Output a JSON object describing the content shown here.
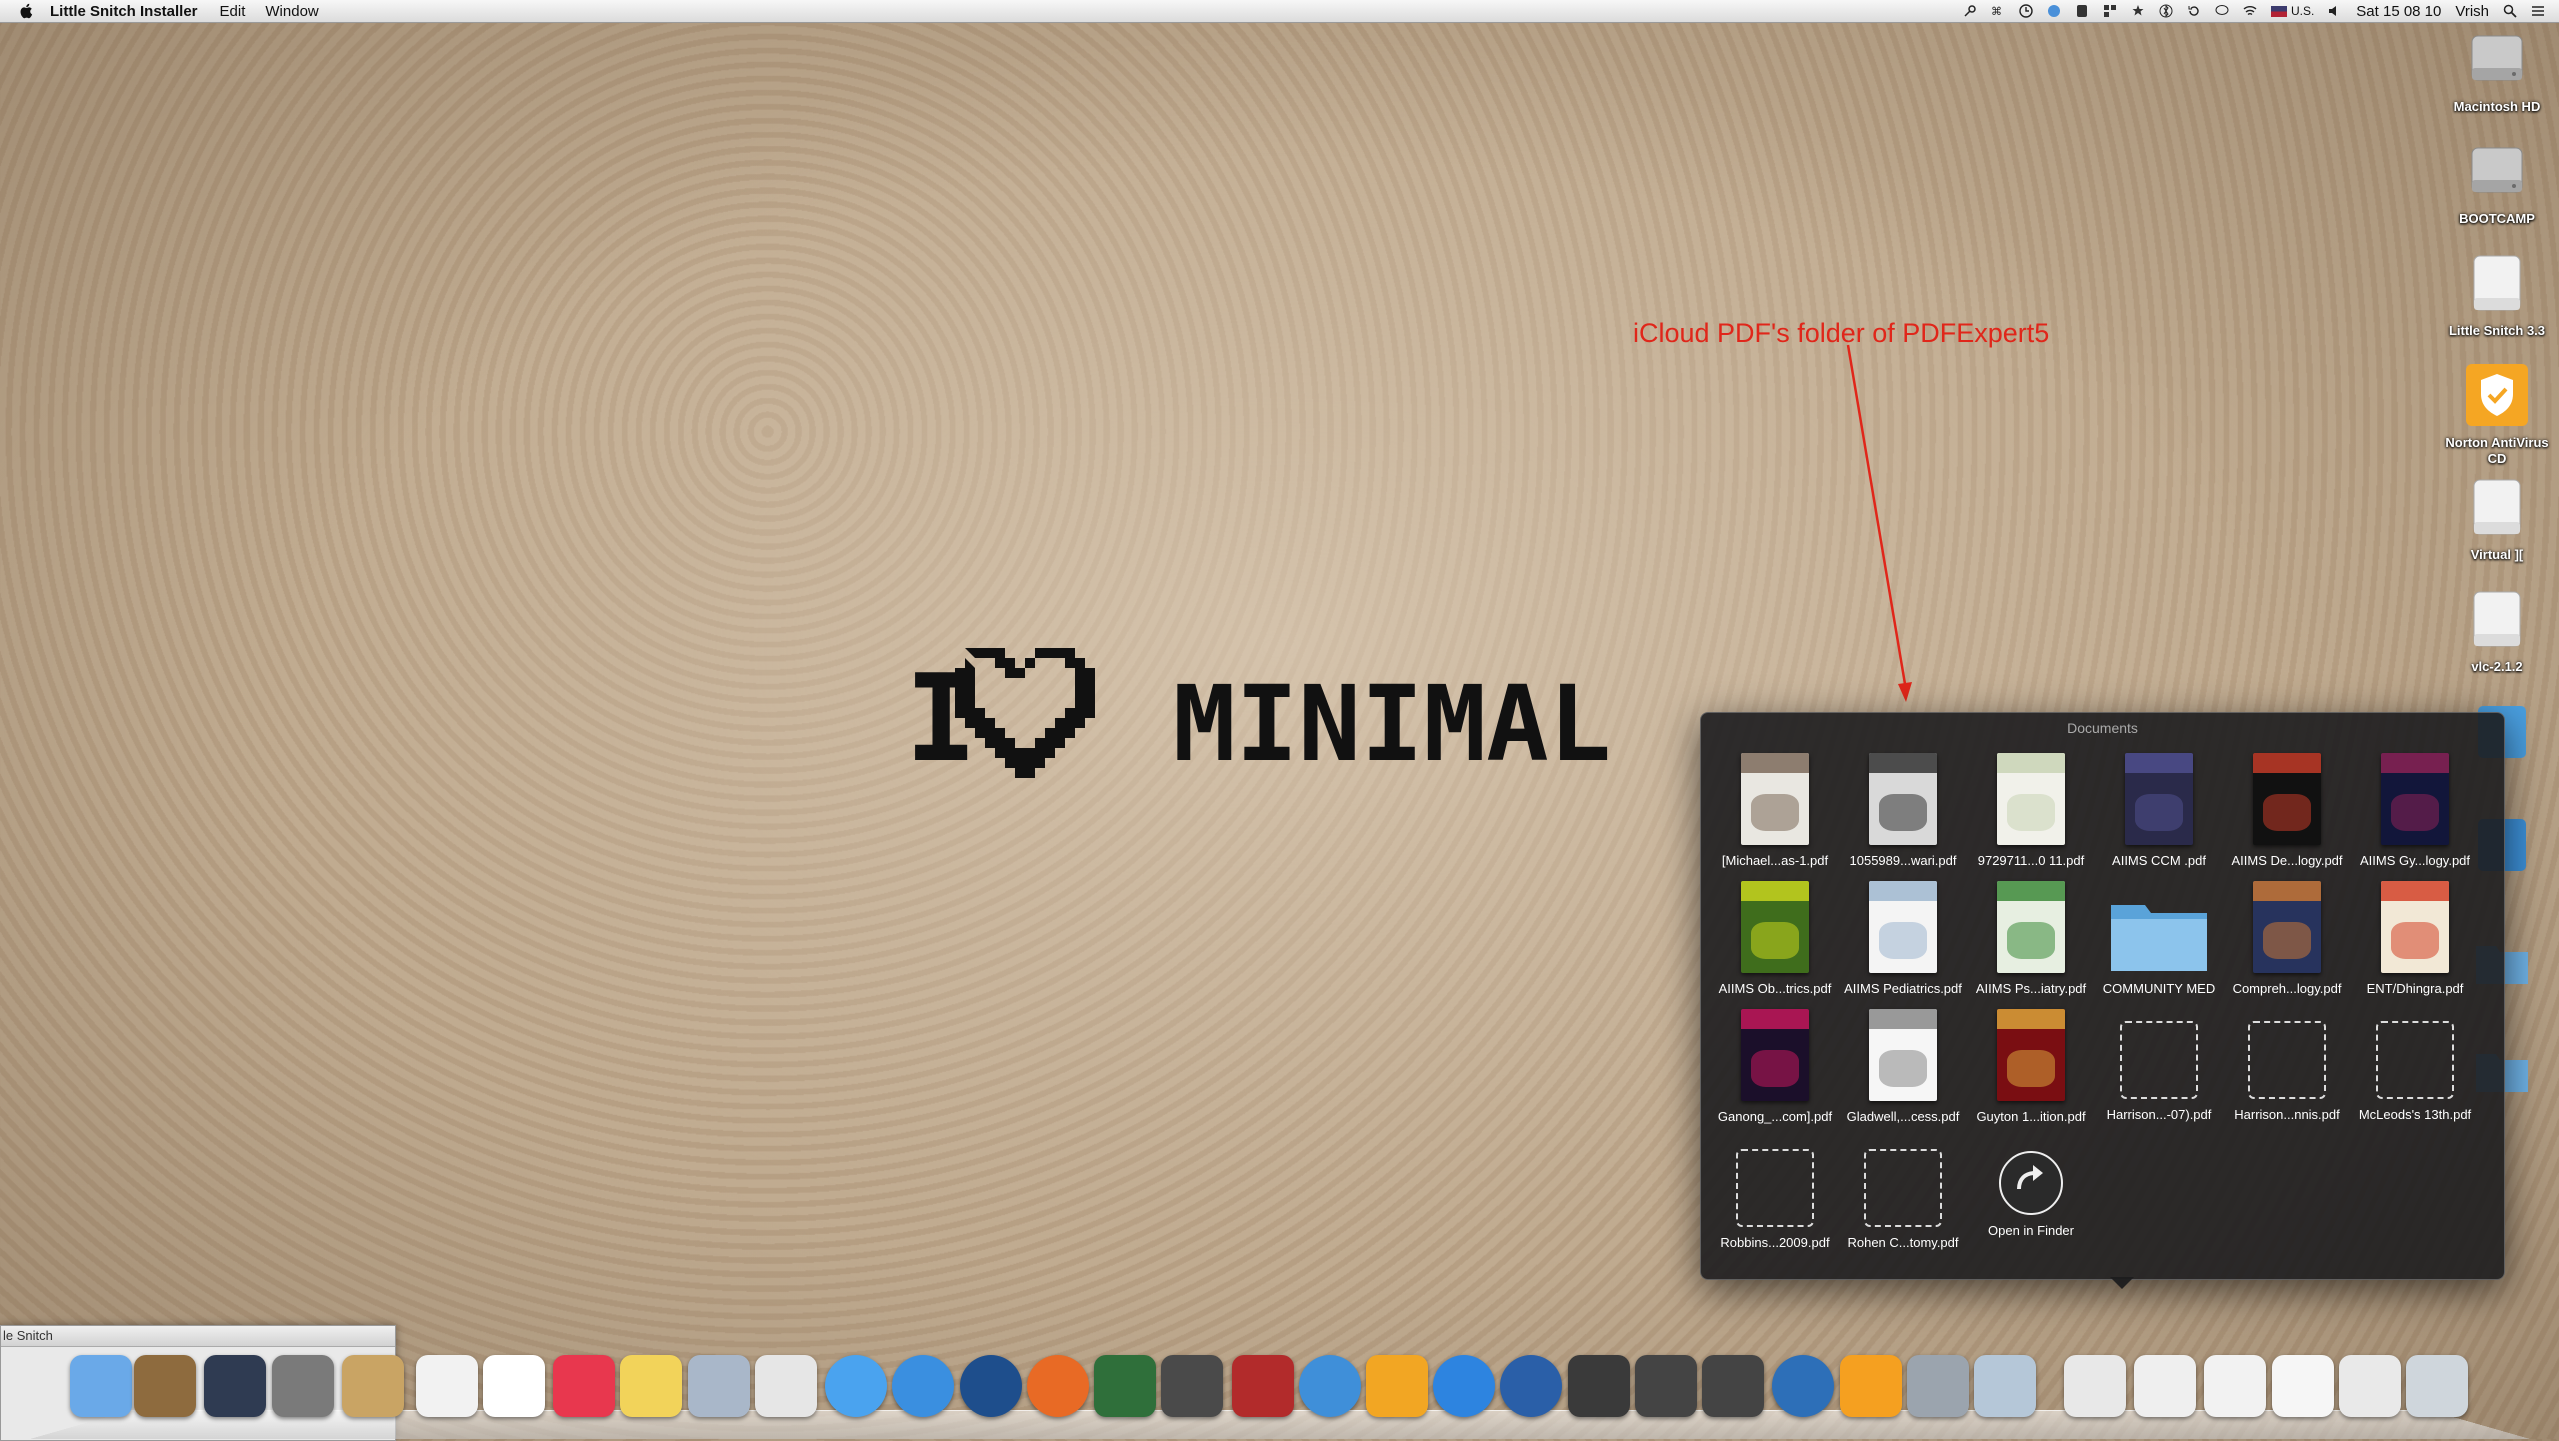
{
  "menubar": {
    "app_name": "Little Snitch Installer",
    "menus": [
      "Edit",
      "Window"
    ],
    "status": {
      "input_source": "U.S.",
      "clock": "Sat 15 08 10",
      "user": "Vrish"
    }
  },
  "wallpaper": {
    "text_left": "I",
    "text_right": "MINIMAL"
  },
  "annotation": {
    "text": "iCloud PDF's folder of PDFExpert5",
    "color": "#e0261a"
  },
  "desktop_icons": [
    {
      "label": "Macintosh HD"
    },
    {
      "label": "BOOTCAMP"
    },
    {
      "label": "Little Snitch 3.3"
    },
    {
      "label": "Norton AntiVirus CD"
    },
    {
      "label": "Virtual ]["
    },
    {
      "label": "vlc-2.1.2"
    }
  ],
  "stack": {
    "title": "Documents",
    "items": [
      {
        "name": "[Michael...as-1.pdf",
        "kind": "pdf",
        "colors": [
          "#e9e7e1",
          "#7c6a5a"
        ]
      },
      {
        "name": "1055989...wari.pdf",
        "kind": "pdf",
        "colors": [
          "#d9d9d9",
          "#333333"
        ]
      },
      {
        "name": "9729711...0 11.pdf",
        "kind": "pdf",
        "colors": [
          "#f1f1ea",
          "#c9d3b5"
        ]
      },
      {
        "name": "AIIMS CCM .pdf",
        "kind": "pdf",
        "colors": [
          "#2a2a4a",
          "#4e4e8c"
        ]
      },
      {
        "name": "AIIMS De...logy.pdf",
        "kind": "pdf",
        "colors": [
          "#111111",
          "#c23b28"
        ]
      },
      {
        "name": "AIIMS Gy...logy.pdf",
        "kind": "pdf",
        "colors": [
          "#12163a",
          "#8a2255"
        ]
      },
      {
        "name": "AIIMS Ob...trics.pdf",
        "kind": "pdf",
        "colors": [
          "#3f6d1c",
          "#c7d31e"
        ]
      },
      {
        "name": "AIIMS Pediatrics.pdf",
        "kind": "pdf",
        "colors": [
          "#f4f4f4",
          "#9fb7cf"
        ]
      },
      {
        "name": "AIIMS Ps...iatry.pdf",
        "kind": "pdf",
        "colors": [
          "#e7efe1",
          "#3d8a3a"
        ]
      },
      {
        "name": "COMMUNITY MED",
        "kind": "folder",
        "colors": [
          "#8cc4ec",
          "#5aa3d9"
        ]
      },
      {
        "name": "Compreh...logy.pdf",
        "kind": "pdf",
        "colors": [
          "#27335d",
          "#c77534"
        ]
      },
      {
        "name": "ENT/Dhingra.pdf",
        "kind": "pdf",
        "colors": [
          "#f2e8d6",
          "#d4432a"
        ]
      },
      {
        "name": "Ganong_...com].pdf",
        "kind": "pdf",
        "colors": [
          "#1b0f2a",
          "#c2185b"
        ]
      },
      {
        "name": "Gladwell,...cess.pdf",
        "kind": "pdf",
        "colors": [
          "#f6f6f6",
          "#888888"
        ]
      },
      {
        "name": "Guyton 1...ition.pdf",
        "kind": "pdf",
        "colors": [
          "#7a0e12",
          "#d9a23a"
        ]
      },
      {
        "name": "Harrison...-07).pdf",
        "kind": "empty"
      },
      {
        "name": "Harrison...nnis.pdf",
        "kind": "empty"
      },
      {
        "name": "McLeods's 13th.pdf",
        "kind": "empty"
      },
      {
        "name": "Robbins...2009.pdf",
        "kind": "empty"
      },
      {
        "name": "Rohen C...tomy.pdf",
        "kind": "empty"
      },
      {
        "name": "Open in Finder",
        "kind": "finder"
      }
    ]
  },
  "little_snitch_window": {
    "title": "le Snitch"
  },
  "dock": {
    "icons": [
      "finder-icon",
      "preview-icon",
      "activity-monitor-icon",
      "system-preferences-icon",
      "address-book-icon",
      "calendar-icon",
      "reminders-icon",
      "pocket-icon",
      "stickies-icon",
      "mail-icon",
      "photo-icon",
      "messages-icon",
      "safari-icon",
      "onepassword-icon",
      "firefox-icon",
      "facetime-icon",
      "time-machine-icon",
      "photo-booth-icon",
      "itunes-icon",
      "app-icon",
      "app-store-icon",
      "quicktime-icon",
      "vlc-icon",
      "folx-icon",
      "folx2-icon",
      "network-icon",
      "fruit-icon",
      "downloads-icon",
      "preview2-icon",
      "stack-icon",
      "documents-icon",
      "docs2-icon",
      "window-icon",
      "window2-icon",
      "trash-icon"
    ]
  }
}
